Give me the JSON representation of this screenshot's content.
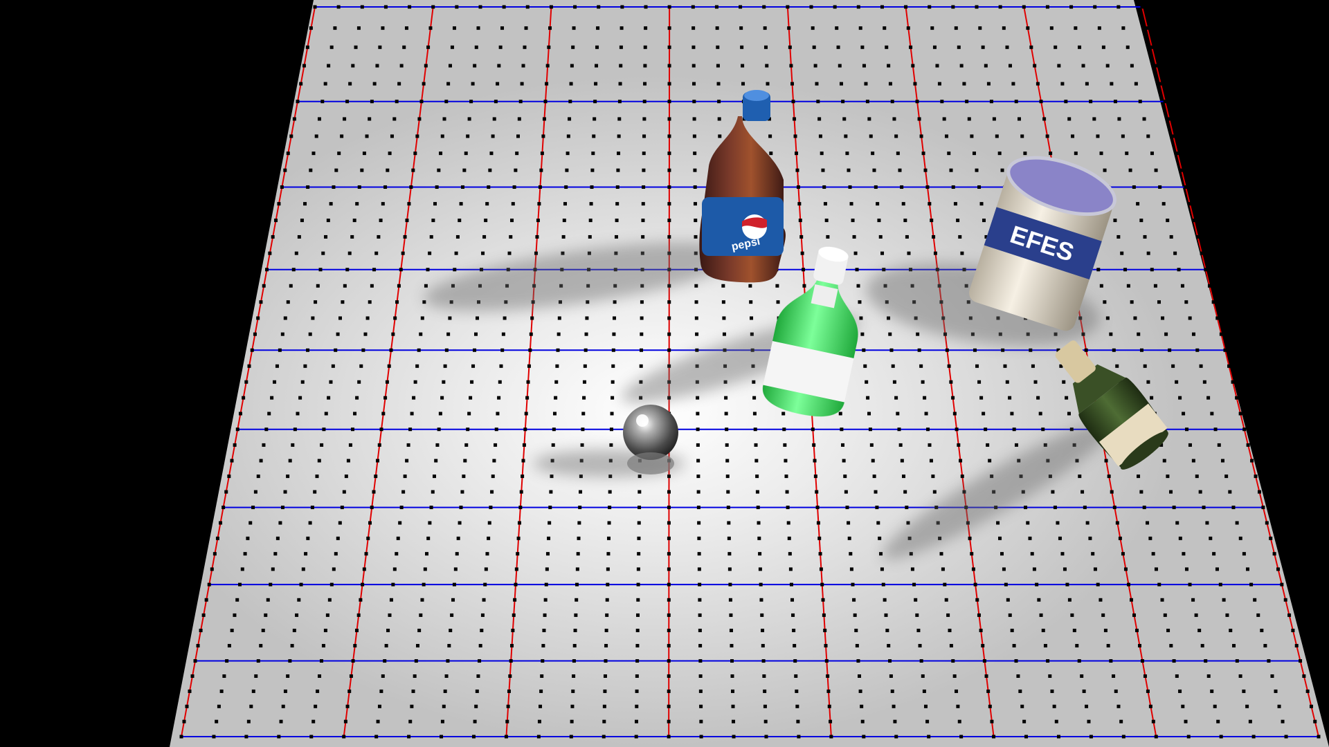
{
  "scene": {
    "background_color": "#000000",
    "table_color": "#d9d9d9",
    "grid": {
      "dot_color": "#000000",
      "major_line_color_depth": "#e00000",
      "major_line_color_width": "#0000e0",
      "major_lines_along_width": 7,
      "major_lines_along_depth": 10,
      "dots_per_cell": 5
    },
    "objects": [
      {
        "name": "pepsi-bottle",
        "kind": "soda bottle",
        "cap_color": "#1f5fb0",
        "body_color": "#5a2a22",
        "label_color": "#1d5aa8",
        "label_text": "pepsi"
      },
      {
        "name": "efes-can",
        "kind": "beer can",
        "lid_color": "#8a84c8",
        "body_color": "#efe8d8",
        "label_color": "#2a3f8c",
        "label_text": "EFES"
      },
      {
        "name": "green-bottle",
        "kind": "glass bottle",
        "cap_color": "#f2f2f2",
        "body_color": "#44ee66",
        "label_color": "#f5f5f5"
      },
      {
        "name": "champagne-bottle",
        "kind": "champagne bottle",
        "body_color": "#3f5a2a",
        "label_color": "#e8dcc0",
        "foil_color": "#d8c8a0"
      },
      {
        "name": "metal-sphere",
        "kind": "chrome ball",
        "body_color": "#8c8c8c"
      }
    ]
  }
}
